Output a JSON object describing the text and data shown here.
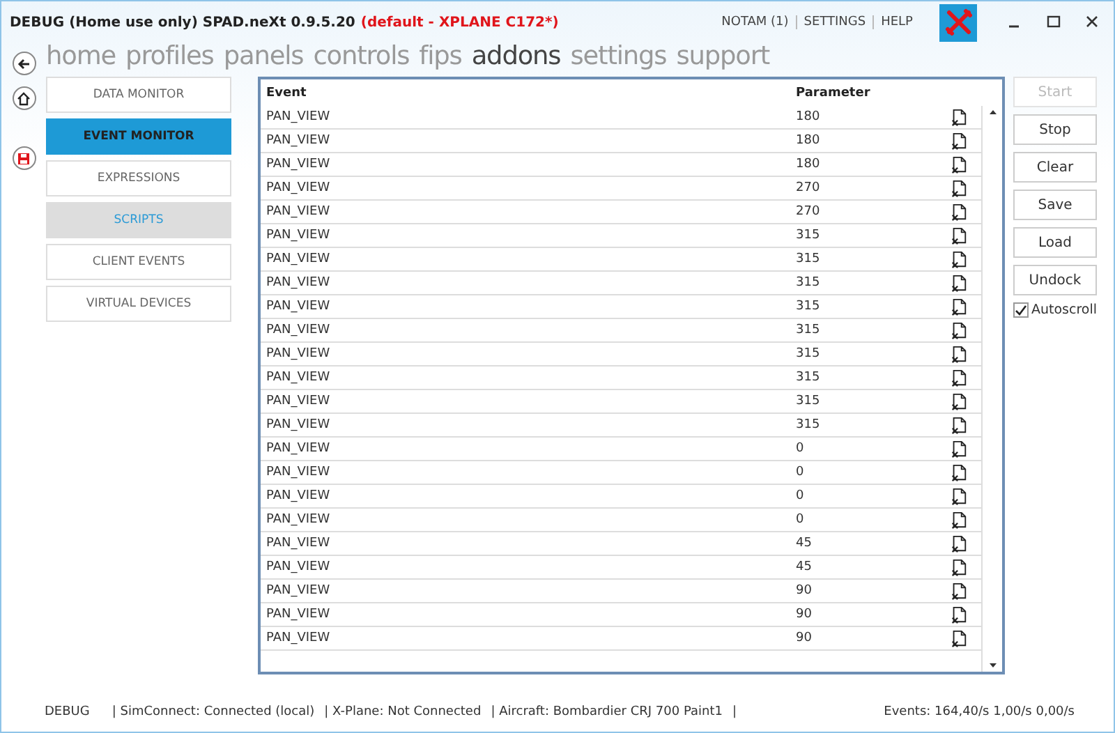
{
  "window": {
    "title": "DEBUG (Home use only) SPAD.neXt 0.9.5.20",
    "profile": "(default - XPLANE C172*)"
  },
  "top_links": [
    "NOTAM (1)",
    "SETTINGS",
    "HELP"
  ],
  "nav": [
    {
      "label": "home",
      "selected": false
    },
    {
      "label": "profiles",
      "selected": false
    },
    {
      "label": "panels",
      "selected": false
    },
    {
      "label": "controls",
      "selected": false
    },
    {
      "label": "fips",
      "selected": false
    },
    {
      "label": "addons",
      "selected": true
    },
    {
      "label": "settings",
      "selected": false
    },
    {
      "label": "support",
      "selected": false
    }
  ],
  "sidebar": {
    "items": [
      {
        "label": "DATA MONITOR",
        "selected": false,
        "highlighted": false
      },
      {
        "label": "EVENT MONITOR",
        "selected": true,
        "highlighted": false
      },
      {
        "label": "EXPRESSIONS",
        "selected": false,
        "highlighted": false
      },
      {
        "label": "SCRIPTS",
        "selected": false,
        "highlighted": true
      },
      {
        "label": "CLIENT EVENTS",
        "selected": false,
        "highlighted": false
      },
      {
        "label": "VIRTUAL DEVICES",
        "selected": false,
        "highlighted": false
      }
    ]
  },
  "table": {
    "columns": [
      "Event",
      "Parameter"
    ],
    "rows": [
      {
        "event": "PAN_VIEW",
        "parameter": "180"
      },
      {
        "event": "PAN_VIEW",
        "parameter": "180"
      },
      {
        "event": "PAN_VIEW",
        "parameter": "180"
      },
      {
        "event": "PAN_VIEW",
        "parameter": "270"
      },
      {
        "event": "PAN_VIEW",
        "parameter": "270"
      },
      {
        "event": "PAN_VIEW",
        "parameter": "315"
      },
      {
        "event": "PAN_VIEW",
        "parameter": "315"
      },
      {
        "event": "PAN_VIEW",
        "parameter": "315"
      },
      {
        "event": "PAN_VIEW",
        "parameter": "315"
      },
      {
        "event": "PAN_VIEW",
        "parameter": "315"
      },
      {
        "event": "PAN_VIEW",
        "parameter": "315"
      },
      {
        "event": "PAN_VIEW",
        "parameter": "315"
      },
      {
        "event": "PAN_VIEW",
        "parameter": "315"
      },
      {
        "event": "PAN_VIEW",
        "parameter": "315"
      },
      {
        "event": "PAN_VIEW",
        "parameter": "0"
      },
      {
        "event": "PAN_VIEW",
        "parameter": "0"
      },
      {
        "event": "PAN_VIEW",
        "parameter": "0"
      },
      {
        "event": "PAN_VIEW",
        "parameter": "0"
      },
      {
        "event": "PAN_VIEW",
        "parameter": "45"
      },
      {
        "event": "PAN_VIEW",
        "parameter": "45"
      },
      {
        "event": "PAN_VIEW",
        "parameter": "90"
      },
      {
        "event": "PAN_VIEW",
        "parameter": "90"
      },
      {
        "event": "PAN_VIEW",
        "parameter": "90"
      }
    ]
  },
  "buttons": [
    {
      "label": "Start",
      "disabled": true
    },
    {
      "label": "Stop",
      "disabled": false
    },
    {
      "label": "Clear",
      "disabled": false
    },
    {
      "label": "Save",
      "disabled": false
    },
    {
      "label": "Load",
      "disabled": false
    },
    {
      "label": "Undock",
      "disabled": false
    }
  ],
  "autoscroll": {
    "label": "Autoscroll",
    "checked": true
  },
  "status_bar": {
    "items": [
      "DEBUG",
      "| SimConnect: Connected (local)",
      "| X-Plane: Not Connected",
      "| Aircraft: Bombardier CRJ 700 Paint1",
      "|"
    ],
    "events": "Events: 164,40/s 1,00/s 0,00/s"
  }
}
